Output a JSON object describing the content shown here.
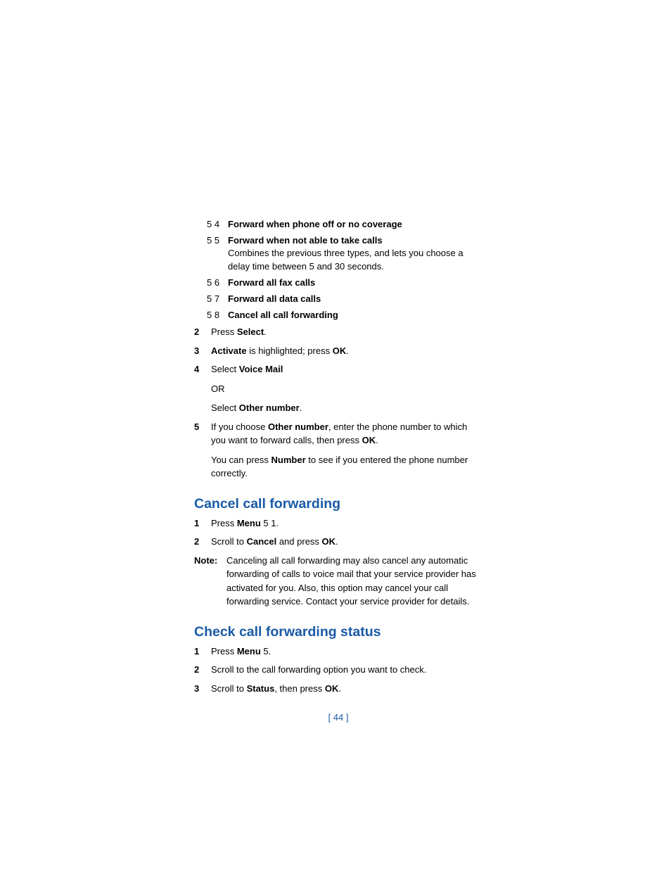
{
  "suboptions": [
    {
      "num": "5 4",
      "title": "Forward when phone off or no coverage",
      "desc": ""
    },
    {
      "num": "5 5",
      "title": "Forward when not able to take calls",
      "desc": "Combines the previous three types, and lets you choose a delay time between 5 and 30 seconds."
    },
    {
      "num": "5 6",
      "title": "Forward all fax calls",
      "desc": ""
    },
    {
      "num": "5 7",
      "title": "Forward all data calls",
      "desc": ""
    },
    {
      "num": "5 8",
      "title": "Cancel all call forwarding",
      "desc": ""
    }
  ],
  "step2": {
    "num": "2",
    "pre": "Press ",
    "b1": "Select",
    "post": "."
  },
  "step3": {
    "num": "3",
    "b1": "Activate",
    "mid": " is highlighted; press ",
    "b2": "OK",
    "post": "."
  },
  "step4": {
    "num": "4",
    "l1_pre": "Select ",
    "l1_b": "Voice Mail",
    "l2": "OR",
    "l3_pre": "Select ",
    "l3_b": "Other number",
    "l3_post": "."
  },
  "step5": {
    "num": "5",
    "p1_a": "If you choose ",
    "p1_b": "Other number",
    "p1_c": ", enter the phone number to which you want to forward calls, then press ",
    "p1_d": "OK",
    "p1_e": ".",
    "p2_a": "You can press ",
    "p2_b": "Number",
    "p2_c": " to see if you entered the phone number correctly."
  },
  "h_cancel": "Cancel call forwarding",
  "cancel_s1": {
    "num": "1",
    "a": "Press ",
    "b": "Menu",
    "c": " 5 1."
  },
  "cancel_s2": {
    "num": "2",
    "a": "Scroll to ",
    "b": "Cancel",
    "c": " and press ",
    "d": "OK",
    "e": "."
  },
  "note": {
    "label": "Note:",
    "text": "Canceling all call forwarding may also cancel any automatic forwarding of calls to voice mail that your service provider has activated for you. Also, this option may cancel your call forwarding service. Contact your service provider for details."
  },
  "h_check": "Check call forwarding status",
  "check_s1": {
    "num": "1",
    "a": "Press ",
    "b": "Menu",
    "c": " 5."
  },
  "check_s2": {
    "num": "2",
    "text": "Scroll to the call forwarding option you want to check."
  },
  "check_s3": {
    "num": "3",
    "a": "Scroll to ",
    "b": "Status",
    "c": ", then press ",
    "d": "OK",
    "e": "."
  },
  "pagenum": "[ 44 ]"
}
